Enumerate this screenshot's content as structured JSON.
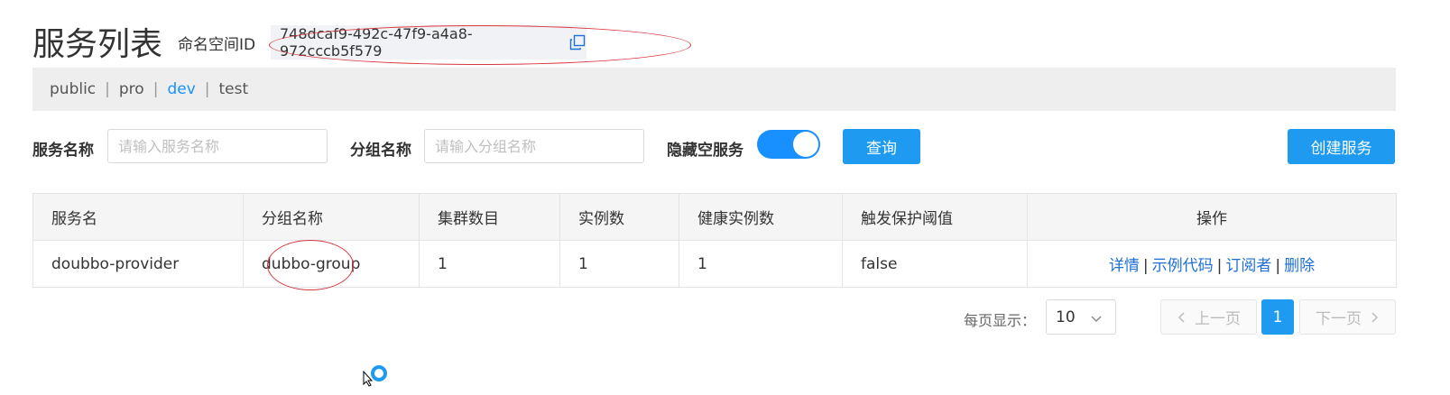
{
  "page": {
    "title": "服务列表"
  },
  "namespace": {
    "label": "命名空间ID",
    "id": "748dcaf9-492c-47f9-a4a8-972cccb5f579"
  },
  "namespaces": {
    "items": [
      {
        "label": "public",
        "active": false
      },
      {
        "label": "pro",
        "active": false
      },
      {
        "label": "dev",
        "active": true
      },
      {
        "label": "test",
        "active": false
      }
    ],
    "separator": "|"
  },
  "filters": {
    "service_label": "服务名称",
    "service_placeholder": "请输入服务名称",
    "group_label": "分组名称",
    "group_placeholder": "请输入分组名称",
    "hide_empty_label": "隐藏空服务",
    "hide_empty_on": true,
    "query_button": "查询",
    "create_button": "创建服务"
  },
  "table": {
    "headers": [
      "服务名",
      "分组名称",
      "集群数目",
      "实例数",
      "健康实例数",
      "触发保护阈值",
      "操作"
    ],
    "rows": [
      {
        "service": "doubbo-provider",
        "group": "dubbo-group",
        "clusters": "1",
        "instances": "1",
        "healthy": "1",
        "threshold": "false",
        "actions": [
          "详情",
          "示例代码",
          "订阅者",
          "删除"
        ]
      }
    ]
  },
  "pagination": {
    "page_size_label": "每页显示：",
    "page_size": "10",
    "prev": "上一页",
    "current": "1",
    "next": "下一页"
  },
  "colors": {
    "accent": "#1e9bf0",
    "link": "#1e6fd9",
    "annotation": "#d9363e"
  }
}
